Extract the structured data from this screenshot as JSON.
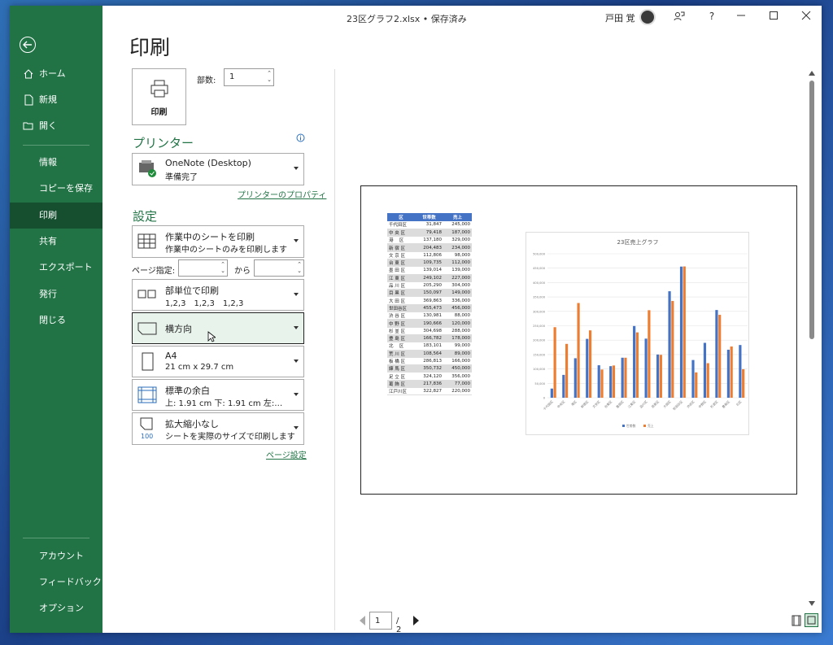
{
  "title": "23区グラフ2.xlsx • 保存済み",
  "user": "戸田 覚",
  "window_controls": {
    "help": "?"
  },
  "nav": {
    "home": "ホーム",
    "new": "新規",
    "open": "開く",
    "info": "情報",
    "saveas": "コピーを保存",
    "print": "印刷",
    "share": "共有",
    "export": "エクスポート",
    "publish": "発行",
    "close": "閉じる",
    "account": "アカウント",
    "feedback": "フィードバック",
    "options": "オプション"
  },
  "heading": "印刷",
  "print_button": "印刷",
  "copies": {
    "label": "部数:",
    "value": "1"
  },
  "printer": {
    "section": "プリンター",
    "name": "OneNote (Desktop)",
    "status": "準備完了",
    "properties": "プリンターのプロパティ"
  },
  "settings": {
    "section": "設定",
    "scope": {
      "l1": "作業中のシートを印刷",
      "l2": "作業中のシートのみを印刷します"
    },
    "pages": {
      "label": "ページ指定:",
      "to": "から",
      "from_value": "",
      "to_value": ""
    },
    "collate": {
      "l1": "部単位で印刷",
      "l2": "1,2,3　1,2,3　1,2,3"
    },
    "orientation": {
      "l1": "横方向"
    },
    "paper": {
      "l1": "A4",
      "l2": "21 cm x 29.7 cm"
    },
    "margins": {
      "l1": "標準の余白",
      "l2": "上: 1.91 cm 下: 1.91 cm 左:…"
    },
    "scaling": {
      "l1": "拡大縮小なし",
      "l2": "シートを実際のサイズで印刷します",
      "badge": "100"
    },
    "page_setup": "ページ設定"
  },
  "pager": {
    "current": "1",
    "total": "/ 2"
  },
  "preview_table": {
    "headers": [
      "区",
      "世帯数",
      "売上"
    ],
    "rows": [
      [
        "千代田区",
        "31,847",
        "245,000"
      ],
      [
        "中 央 区",
        "79,418",
        "187,000"
      ],
      [
        "港　 区",
        "137,180",
        "329,000"
      ],
      [
        "新 宿 区",
        "204,483",
        "234,000"
      ],
      [
        "文 京 区",
        "112,806",
        "98,000"
      ],
      [
        "台 東 区",
        "109,735",
        "112,000"
      ],
      [
        "墨 田 区",
        "139,014",
        "139,000"
      ],
      [
        "江 東 区",
        "249,102",
        "227,000"
      ],
      [
        "品 川 区",
        "205,290",
        "304,000"
      ],
      [
        "目 黒 区",
        "150,097",
        "149,000"
      ],
      [
        "大 田 区",
        "369,863",
        "336,000"
      ],
      [
        "世田谷区",
        "455,473",
        "456,000"
      ],
      [
        "渋 谷 区",
        "130,981",
        "88,000"
      ],
      [
        "中 野 区",
        "190,666",
        "120,000"
      ],
      [
        "杉 並 区",
        "304,698",
        "288,000"
      ],
      [
        "豊 島 区",
        "166,782",
        "178,000"
      ],
      [
        "北　 区",
        "183,101",
        "99,000"
      ],
      [
        "荒 川 区",
        "108,564",
        "89,000"
      ],
      [
        "板 橋 区",
        "286,813",
        "166,000"
      ],
      [
        "練 馬 区",
        "350,732",
        "450,000"
      ],
      [
        "足 立 区",
        "324,120",
        "356,000"
      ],
      [
        "葛 飾 区",
        "217,836",
        "77,000"
      ],
      [
        "江戸川区",
        "322,827",
        "220,000"
      ]
    ]
  },
  "chart_data": {
    "type": "bar",
    "title": "23区売上グラフ",
    "categories": [
      "千代田区",
      "中央区",
      "港区",
      "新宿区",
      "文京区",
      "台東区",
      "墨田区",
      "江東区",
      "品川区",
      "目黒区",
      "大田区",
      "世田谷区",
      "渋谷区",
      "中野区",
      "杉並区",
      "豊島区",
      "北区"
    ],
    "ylim": [
      0,
      500000
    ],
    "yticks": [
      "0",
      "50,000",
      "100,000",
      "150,000",
      "200,000",
      "250,000",
      "300,000",
      "350,000",
      "400,000",
      "450,000",
      "500,000"
    ],
    "series": [
      {
        "name": "世帯数",
        "color": "#4472c4",
        "values": [
          31847,
          79418,
          137180,
          204483,
          112806,
          109735,
          139014,
          249102,
          205290,
          150097,
          369863,
          455473,
          130981,
          190666,
          304698,
          166782,
          183101
        ]
      },
      {
        "name": "売上",
        "color": "#ed7d31",
        "values": [
          245000,
          187000,
          329000,
          234000,
          98000,
          112000,
          139000,
          227000,
          304000,
          149000,
          336000,
          456000,
          88000,
          120000,
          288000,
          178000,
          99000
        ]
      }
    ],
    "legend": "bottom",
    "grid": true
  },
  "colors": {
    "accent": "#217346"
  }
}
